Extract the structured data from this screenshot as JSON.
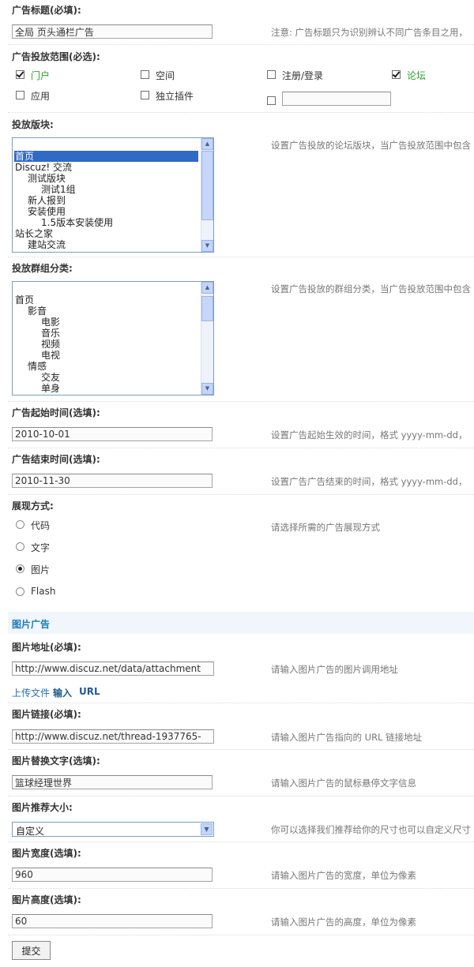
{
  "ad_title": {
    "label": "广告标题(必填):",
    "value": "全局 页头通栏广告",
    "hint": "注意: 广告标题只为识别辨认不同广告条目之用，"
  },
  "scope": {
    "label": "广告投放范围(必选):",
    "options": [
      {
        "label": "门户",
        "checked": true
      },
      {
        "label": "空间",
        "checked": false
      },
      {
        "label": "注册/登录",
        "checked": false
      },
      {
        "label": "论坛",
        "checked": true
      },
      {
        "label": "应用",
        "checked": false
      },
      {
        "label": "独立插件",
        "checked": false
      },
      {
        "label": "",
        "checked": false
      }
    ],
    "custom_value": ""
  },
  "forums": {
    "label": "投放版块:",
    "hint": "设置广告投放的论坛版块，当广告投放范围中包含",
    "items": [
      "首页",
      "Discuz! 交流",
      "测试版块",
      "测试1组",
      "新人报到",
      "安装使用",
      "1.5版本安装使用",
      "站长之家",
      "建站交流"
    ],
    "selected": "首页"
  },
  "groups": {
    "label": "投放群组分类:",
    "hint": "设置广告投放的群组分类，当广告投放范围中包含",
    "items": [
      "首页",
      "影音",
      "电影",
      "音乐",
      "视频",
      "电视",
      "情感",
      "交友",
      "单身"
    ]
  },
  "start_time": {
    "label": "广告起始时间(选填):",
    "value": "2010-10-01",
    "hint": "设置广告起始生效的时间，格式 yyyy-mm-dd，"
  },
  "end_time": {
    "label": "广告结束时间(选填):",
    "value": "2010-11-30",
    "hint": "设置广告广告结束的时间，格式 yyyy-mm-dd，"
  },
  "display": {
    "label": "展现方式:",
    "hint": "请选择所需的广告展现方式",
    "options": [
      {
        "label": "代码",
        "checked": false
      },
      {
        "label": "文字",
        "checked": false
      },
      {
        "label": "图片",
        "checked": true
      },
      {
        "label": "Flash",
        "checked": false
      }
    ]
  },
  "image_section": {
    "title": "图片广告"
  },
  "image_url": {
    "label": "图片地址(必填):",
    "value": "http://www.discuz.net/data/attachment",
    "hint": "请输入图片广告的图片调用地址"
  },
  "upload_links": {
    "upload": "上传文件",
    "input": "输入",
    "url": "URL"
  },
  "image_link": {
    "label": "图片链接(必填):",
    "value": "http://www.discuz.net/thread-1937765-",
    "hint": "请输入图片广告指向的 URL 链接地址"
  },
  "image_alt": {
    "label": "图片替换文字(选填):",
    "value": "篮球经理世界",
    "hint": "请输入图片广告的鼠标悬停文字信息"
  },
  "image_size": {
    "label": "图片推荐大小:",
    "value": "自定义",
    "hint": "你可以选择我们推荐给你的尺寸也可以自定义尺寸"
  },
  "image_width": {
    "label": "图片宽度(选填):",
    "value": "960",
    "hint": "请输入图片广告的宽度，单位为像素"
  },
  "image_height": {
    "label": "图片高度(选填):",
    "value": "60",
    "hint": "请输入图片广告的高度，单位为像素"
  },
  "submit": {
    "label": "提交"
  }
}
